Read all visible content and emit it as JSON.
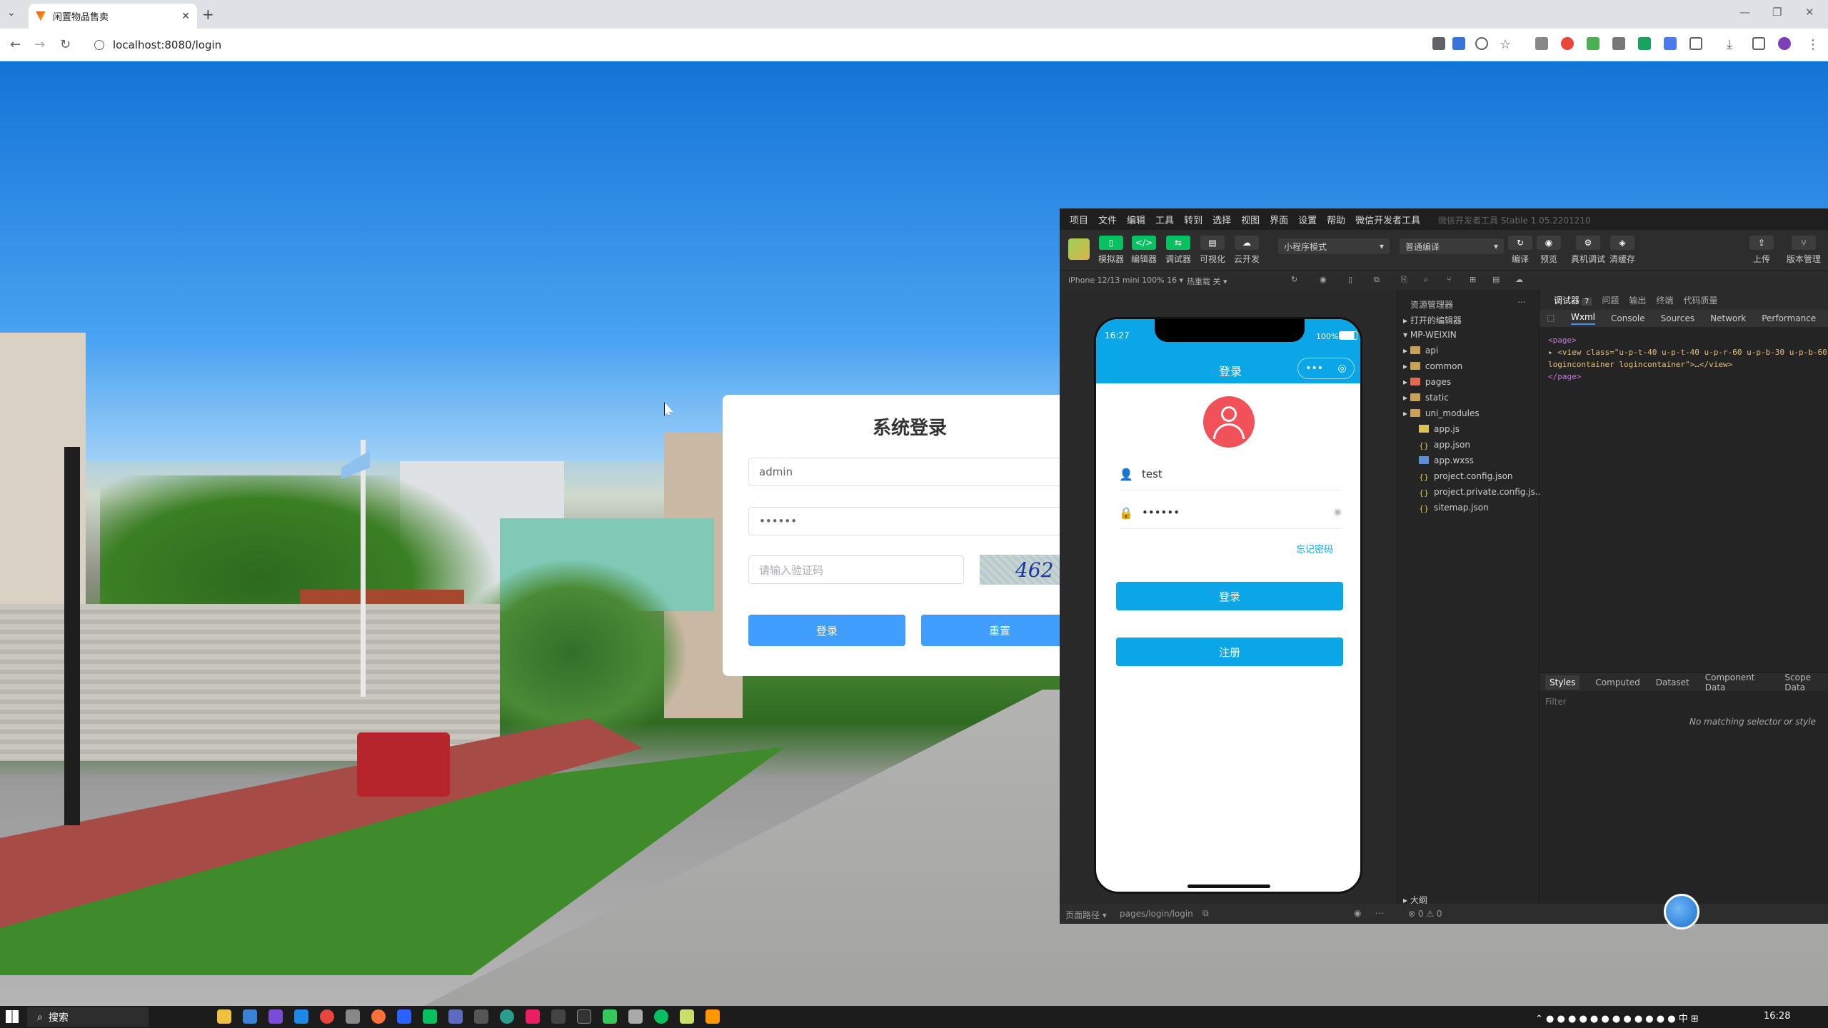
{
  "browser": {
    "tab_title": "闲置物品售卖",
    "url": "localhost:8080/login"
  },
  "login": {
    "title": "系统登录",
    "username": "admin",
    "password": "••••••",
    "captcha_placeholder": "请输入验证码",
    "captcha_text": "462",
    "login_button": "登录",
    "reset_button": "重置"
  },
  "devtools": {
    "menu": [
      "项目",
      "文件",
      "编辑",
      "工具",
      "转到",
      "选择",
      "视图",
      "界面",
      "设置",
      "帮助",
      "微信开发者工具"
    ],
    "version": "微信开发者工具 Stable 1.05.2201210",
    "toolbar": [
      "模拟器",
      "编辑器",
      "调试器",
      "可视化",
      "云开发"
    ],
    "mode_select": "小程序模式",
    "compile_select": "普通编译",
    "right_toolbar": [
      "编译",
      "预览",
      "真机调试",
      "清缓存"
    ],
    "far_right_toolbar": [
      "上传",
      "版本管理"
    ],
    "device": "iPhone 12/13 mini 100% 16 ▾",
    "hotreload": "热重载 关 ▾",
    "explorer_title": "资源管理器",
    "open_editors": "打开的编辑器",
    "project": "MP-WEIXIN",
    "tree": [
      {
        "name": "api",
        "type": "folder"
      },
      {
        "name": "common",
        "type": "folder"
      },
      {
        "name": "pages",
        "type": "folder-red"
      },
      {
        "name": "static",
        "type": "folder"
      },
      {
        "name": "uni_modules",
        "type": "folder"
      },
      {
        "name": "app.js",
        "type": "js"
      },
      {
        "name": "app.json",
        "type": "json"
      },
      {
        "name": "app.wxss",
        "type": "wxss"
      },
      {
        "name": "project.config.json",
        "type": "json"
      },
      {
        "name": "project.private.config.js...",
        "type": "json"
      },
      {
        "name": "sitemap.json",
        "type": "json"
      }
    ],
    "outline": "大纲",
    "debug_tabs": [
      "调试器",
      "问题",
      "输出",
      "终端",
      "代码质量"
    ],
    "debug_badge": "7",
    "panel_tabs": [
      "Wxml",
      "Console",
      "Sources",
      "Network",
      "Performance"
    ],
    "wxml_lines": [
      "<page>",
      "▸ <view class=\"u-p-t-40 u-p-t-40 u-p-r-60 u-p-b-30 u-p-b-60 logincontainer logincontainer\">…</view>",
      "</page>"
    ],
    "style_tabs": [
      "Styles",
      "Computed",
      "Dataset",
      "Component Data",
      "Scope Data"
    ],
    "filter": "Filter",
    "no_match": "No matching selector or style",
    "page_path_label": "页面路径 ▾",
    "page_path": "pages/login/login",
    "errors": "⊗ 0 ⚠ 0"
  },
  "phone": {
    "time": "16:27",
    "battery": "100%",
    "title": "登录",
    "username": "test",
    "password": "••••••",
    "forgot": "忘记密码",
    "login_button": "登录",
    "register_button": "注册"
  },
  "taskbar": {
    "search": "搜索",
    "ime": "中",
    "time": "16:28"
  }
}
